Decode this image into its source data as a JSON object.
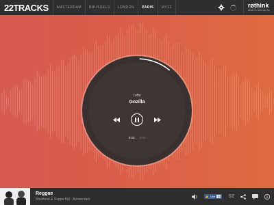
{
  "header": {
    "logo": "22TRACKS",
    "cities": [
      {
        "label": "AMSTERDAM",
        "active": false
      },
      {
        "label": "BRUSSELS",
        "active": false
      },
      {
        "label": "LONDON",
        "active": false
      },
      {
        "label": "PARIS",
        "active": true
      },
      {
        "label": "MY22",
        "active": false
      }
    ],
    "brand": {
      "name": "røthink",
      "tagline": "what the web can be"
    }
  },
  "player": {
    "artist": "Lefto",
    "title": "Gozilla",
    "current_time": "0:23",
    "total_time": "3:41",
    "progress": 0.1
  },
  "footer": {
    "genre": "Reggae",
    "description": "Waxfiend & Suppa Kid - Amsterdam",
    "like_label": "Like",
    "like_count": "0",
    "s2_label": "S2"
  },
  "colors": {
    "topbar": "#2f2f2f",
    "gradient_start": "#d65a52",
    "gradient_end": "#de6a3f",
    "disc": "#3a3030"
  },
  "icons": [
    "gear-icon",
    "loading-spinner-icon",
    "rewind-icon",
    "pause-icon",
    "fast-forward-icon",
    "volume-icon",
    "facebook-like-icon",
    "share-icon",
    "chat-icon",
    "info-icon"
  ]
}
